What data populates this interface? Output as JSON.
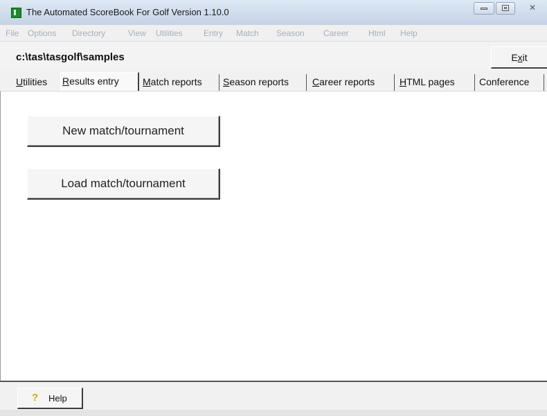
{
  "window": {
    "title": "The Automated ScoreBook For Golf  Version 1.10.0",
    "controls": {
      "minimize_icon": "minimize-icon",
      "maximize_icon": "maximize-icon",
      "close_glyph": "✕"
    }
  },
  "menubar": {
    "items": [
      "File",
      "Options",
      "Directory",
      "View",
      "Utilities",
      "Entry",
      "Match",
      "Season",
      "Career",
      "Html",
      "Help"
    ]
  },
  "path": {
    "text": "c:\\tas\\tasgolf\\samples"
  },
  "toolbar": {
    "exit_label": "Exit",
    "exit_mnemonic": "x"
  },
  "tabs": [
    {
      "label": "Utilities",
      "mnemonic": "U",
      "active": false
    },
    {
      "label": "Results entry",
      "mnemonic": "R",
      "active": true
    },
    {
      "label": "Match reports",
      "mnemonic": "M",
      "active": false
    },
    {
      "label": "Season reports",
      "mnemonic": "S",
      "active": false
    },
    {
      "label": "Career reports",
      "mnemonic": "C",
      "active": false
    },
    {
      "label": "HTML pages",
      "mnemonic": "H",
      "active": false
    },
    {
      "label": "Conference",
      "mnemonic": "",
      "active": false
    }
  ],
  "panel": {
    "new_button_label": "New match/tournament",
    "load_button_label": "Load match/tournament"
  },
  "footer": {
    "help_label": "Help",
    "help_icon_glyph": "?",
    "help_icon_color": "#e8a400"
  },
  "colors": {
    "titlebar": "#cfdcec",
    "menu_disabled_text": "#a8aeb8",
    "app_icon": "#1d8a2a"
  }
}
